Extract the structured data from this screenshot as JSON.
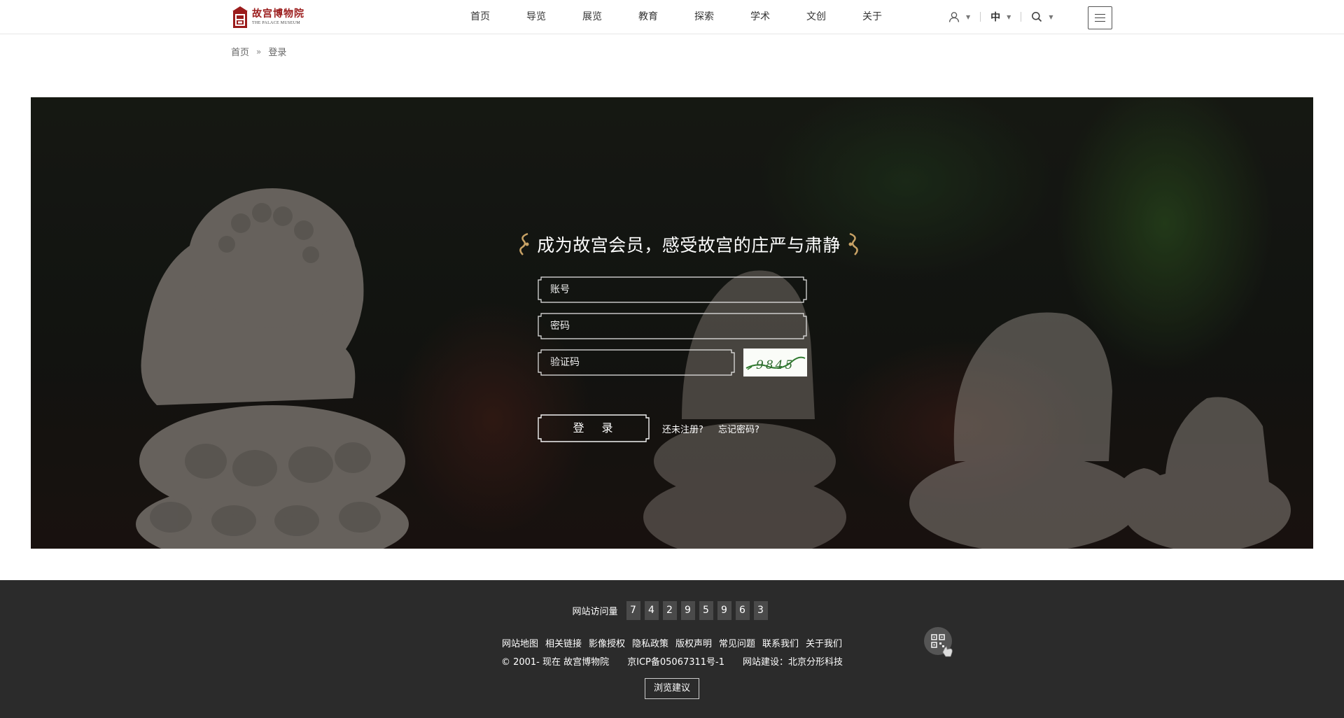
{
  "header": {
    "logo_cn": "故宫博物院",
    "logo_en": "THE PALACE MUSEUM",
    "nav": [
      {
        "label": "首页"
      },
      {
        "label": "导览"
      },
      {
        "label": "展览"
      },
      {
        "label": "教育"
      },
      {
        "label": "探索"
      },
      {
        "label": "学术"
      },
      {
        "label": "文创"
      },
      {
        "label": "关于"
      }
    ],
    "language": "中",
    "icons": {
      "user": "user-icon",
      "search": "search-icon",
      "menu": "hamburger-menu-icon"
    }
  },
  "breadcrumb": {
    "home": "首页",
    "separator": "»",
    "current": "登录"
  },
  "login": {
    "slogan": "成为故宫会员，感受故宫的庄严与肃静",
    "account_placeholder": "账号",
    "password_placeholder": "密码",
    "captcha_placeholder": "验证码",
    "captcha_code": "9845",
    "submit_label": "登 录",
    "register_link": "还未注册?",
    "forgot_link": "忘记密码?"
  },
  "footer": {
    "visits_label": "网站访问量",
    "visit_digits": [
      "7",
      "4",
      "2",
      "9",
      "5",
      "9",
      "6",
      "3"
    ],
    "links": [
      "网站地图",
      "相关链接",
      "影像授权",
      "隐私政策",
      "版权声明",
      "常见问题",
      "联系我们",
      "关于我们"
    ],
    "copyright": "© 2001- 现在 故宫博物院",
    "icp": "京ICP备05067311号-1",
    "builder": "网站建设：北京分形科技",
    "feedback_label": "浏览建议"
  },
  "colors": {
    "brand_red": "#9b1c1c",
    "footer_bg": "#2b2b2b",
    "ornament_gold": "#c8a265"
  }
}
